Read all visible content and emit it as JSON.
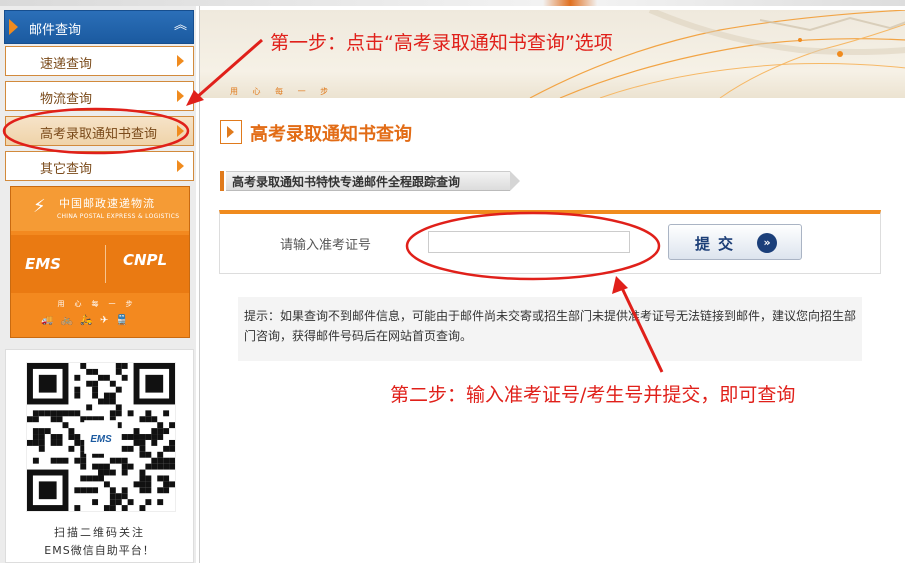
{
  "sidebar": {
    "header": "邮件查询",
    "collapse_icon": "︽",
    "items": [
      {
        "label": "速递查询"
      },
      {
        "label": "物流查询"
      },
      {
        "label": "高考录取通知书查询"
      },
      {
        "label": "其它查询"
      }
    ],
    "banner": {
      "cn_title": "中国邮政速递物流",
      "en_title": "CHINA POSTAL EXPRESS & LOGISTICS",
      "ems": "EMS",
      "cnpl": "CNPL",
      "slogan": "用心每一步"
    },
    "qr": {
      "center_logo": "EMS",
      "line1": "扫描二维码关注",
      "line2": "EMS微信自助平台！"
    }
  },
  "main": {
    "hero_icons": "用 心 每 一 步",
    "page_title": "高考录取通知书查询",
    "sub_tab": "高考录取通知书特快专递邮件全程跟踪查询",
    "query": {
      "label": "请输入准考证号",
      "input_value": "",
      "submit_label": "提交",
      "submit_icon": "»"
    },
    "tip": "提示：如果查询不到邮件信息，可能由于邮件尚未交寄或招生部门未提供准考证号无法链接到邮件，建议您向招生部门咨询，获得邮件号码后在网站首页查询。"
  },
  "annotations": {
    "step1": "第一步：点击“高考录取通知书查询”选项",
    "step2": "第二步：输入准考证号/考生号并提交，即可查询"
  },
  "colors": {
    "accent_orange": "#f08b1e",
    "header_blue": "#1b5aa0",
    "annotation_red": "#e0201a"
  }
}
